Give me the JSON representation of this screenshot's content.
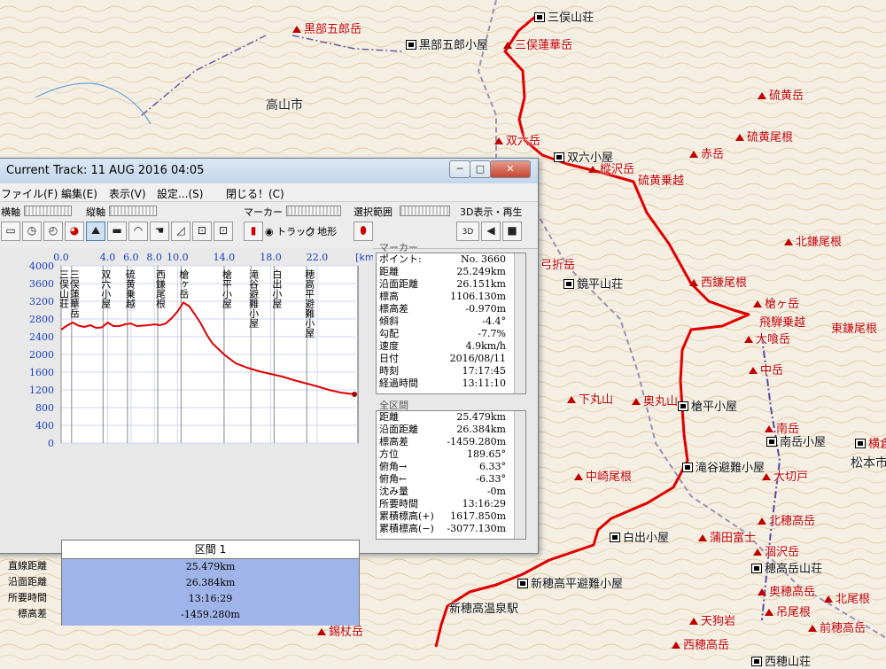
{
  "map": {
    "labels": [
      {
        "text": "黒部五郎岳",
        "cls": "maplabel",
        "x": 330,
        "y": 22,
        "icon": "mtn"
      },
      {
        "text": "黒部五郎小屋",
        "cls": "maplabel black",
        "x": 458,
        "y": 40,
        "icon": "hut"
      },
      {
        "text": "三俣山荘",
        "cls": "maplabel black",
        "x": 603,
        "y": 9,
        "icon": "hut"
      },
      {
        "text": "三俣蓮華岳",
        "cls": "maplabel",
        "x": 568,
        "y": 40,
        "icon": "mtn"
      },
      {
        "text": "高山市",
        "cls": "maplabel city",
        "x": 300,
        "y": 108,
        "icon": ""
      },
      {
        "text": "双六岳",
        "cls": "maplabel",
        "x": 558,
        "y": 148,
        "icon": "mtn"
      },
      {
        "text": "双六小屋",
        "cls": "maplabel black",
        "x": 625,
        "y": 167,
        "icon": "hut"
      },
      {
        "text": "樅沢岳",
        "cls": "maplabel",
        "x": 664,
        "y": 180,
        "icon": "mtn"
      },
      {
        "text": "硫黄乗越",
        "cls": "maplabel",
        "x": 720,
        "y": 193,
        "icon": ""
      },
      {
        "text": "硫黄岳",
        "cls": "maplabel",
        "x": 855,
        "y": 97,
        "icon": "mtn"
      },
      {
        "text": "硫黄尾根",
        "cls": "maplabel",
        "x": 830,
        "y": 144,
        "icon": "mtn"
      },
      {
        "text": "赤岳",
        "cls": "maplabel",
        "x": 778,
        "y": 163,
        "icon": "mtn"
      },
      {
        "text": "北鎌尾根",
        "cls": "maplabel",
        "x": 885,
        "y": 262,
        "icon": "mtn"
      },
      {
        "text": "弓折岳",
        "cls": "maplabel",
        "x": 610,
        "y": 288,
        "icon": ""
      },
      {
        "text": "鏡平山荘",
        "cls": "maplabel black",
        "x": 636,
        "y": 310,
        "icon": "hut"
      },
      {
        "text": "西鎌尾根",
        "cls": "maplabel",
        "x": 778,
        "y": 308,
        "icon": "mtn"
      },
      {
        "text": "槍ヶ岳",
        "cls": "maplabel",
        "x": 850,
        "y": 332,
        "icon": "mtn"
      },
      {
        "text": "飛騨乗越",
        "cls": "maplabel",
        "x": 857,
        "y": 353,
        "icon": ""
      },
      {
        "text": "東鎌尾根",
        "cls": "maplabel",
        "x": 938,
        "y": 360,
        "icon": ""
      },
      {
        "text": "大喰岳",
        "cls": "maplabel",
        "x": 840,
        "y": 372,
        "icon": "mtn"
      },
      {
        "text": "中岳",
        "cls": "maplabel",
        "x": 845,
        "y": 407,
        "icon": "mtn"
      },
      {
        "text": "下丸山",
        "cls": "maplabel",
        "x": 640,
        "y": 440,
        "icon": "mtn"
      },
      {
        "text": "奥丸山",
        "cls": "maplabel",
        "x": 713,
        "y": 442,
        "icon": "mtn"
      },
      {
        "text": "槍平小屋",
        "cls": "maplabel black",
        "x": 765,
        "y": 448,
        "icon": "hut"
      },
      {
        "text": "南岳",
        "cls": "maplabel",
        "x": 863,
        "y": 473,
        "icon": "mtn"
      },
      {
        "text": "南岳小屋",
        "cls": "maplabel black",
        "x": 865,
        "y": 488,
        "icon": "hut"
      },
      {
        "text": "中崎尾根",
        "cls": "maplabel",
        "x": 648,
        "y": 527,
        "icon": "mtn"
      },
      {
        "text": "滝谷避難小屋",
        "cls": "maplabel black",
        "x": 770,
        "y": 517,
        "icon": "hut"
      },
      {
        "text": "大切戸",
        "cls": "maplabel",
        "x": 860,
        "y": 527,
        "icon": "mtn"
      },
      {
        "text": "横倉",
        "cls": "maplabel",
        "x": 965,
        "y": 490,
        "icon": "hut"
      },
      {
        "text": "松本市",
        "cls": "maplabel city",
        "x": 960,
        "y": 512,
        "icon": ""
      },
      {
        "text": "北穂高岳",
        "cls": "maplabel",
        "x": 855,
        "y": 577,
        "icon": "mtn"
      },
      {
        "text": "白出小屋",
        "cls": "maplabel black",
        "x": 688,
        "y": 596,
        "icon": "hut"
      },
      {
        "text": "蒲田富士",
        "cls": "maplabel",
        "x": 788,
        "y": 596,
        "icon": "mtn"
      },
      {
        "text": "涸沢岳",
        "cls": "maplabel",
        "x": 850,
        "y": 612,
        "icon": "mtn"
      },
      {
        "text": "穂高岳山荘",
        "cls": "maplabel black",
        "x": 848,
        "y": 631,
        "icon": "hut"
      },
      {
        "text": "新穂高平避難小屋",
        "cls": "maplabel black",
        "x": 584,
        "y": 648,
        "icon": "hut"
      },
      {
        "text": "奥穂高岳",
        "cls": "maplabel",
        "x": 855,
        "y": 657,
        "icon": "mtn"
      },
      {
        "text": "北尾根",
        "cls": "maplabel",
        "x": 930,
        "y": 665,
        "icon": "mtn"
      },
      {
        "text": "新穂高温泉駅",
        "cls": "maplabel black",
        "x": 507,
        "y": 676,
        "icon": ""
      },
      {
        "text": "吊尾根",
        "cls": "maplabel",
        "x": 863,
        "y": 680,
        "icon": "mtn"
      },
      {
        "text": "天狗岩",
        "cls": "maplabel",
        "x": 778,
        "y": 690,
        "icon": "mtn"
      },
      {
        "text": "前穂高岳",
        "cls": "maplabel",
        "x": 912,
        "y": 698,
        "icon": "mtn"
      },
      {
        "text": "錫杖岳",
        "cls": "maplabel",
        "x": 358,
        "y": 702,
        "icon": "mtn"
      },
      {
        "text": "西穂高岳",
        "cls": "maplabel",
        "x": 758,
        "y": 717,
        "icon": "mtn"
      },
      {
        "text": "西穂山荘",
        "cls": "maplabel black",
        "x": 848,
        "y": 736,
        "icon": "hut"
      }
    ]
  },
  "window": {
    "title": "Current Track: 11 AUG 2016 04:05",
    "controls": {
      "min": "─",
      "max": "□",
      "close": "✕"
    },
    "menu": [
      "ファイル(F)",
      "編集(E)",
      "表示(V)",
      "設定...(S)",
      "閉じる！(C)"
    ],
    "toolbar": {
      "yoko_label": "横軸",
      "tate_label": "縦軸",
      "marker_label": "マーカー",
      "select_label": "選択範囲",
      "view3d_label": "3D表示・再生",
      "track_radio": "トラック",
      "terrain_radio": "地形",
      "btn_3d": "3D"
    }
  },
  "chart_data": {
    "type": "line",
    "x_unit": "[km]",
    "x_ticks": [
      "0.0",
      "4.0",
      "6.0",
      "8.0",
      "10.0",
      "14.0",
      "18.0",
      "22.0"
    ],
    "x_tick_vals": [
      0,
      4,
      6,
      8,
      10,
      14,
      18,
      22
    ],
    "xlim": [
      0,
      25.5
    ],
    "ylim": [
      0,
      4000
    ],
    "y_ticks": [
      "4000",
      "3600",
      "3200",
      "2800",
      "2400",
      "2000",
      "1600",
      "1200",
      "800",
      "400",
      "0"
    ],
    "x": [
      0,
      0.5,
      1,
      1.5,
      2,
      2.5,
      3,
      3.5,
      4,
      4.5,
      5,
      5.5,
      6,
      6.5,
      7,
      7.5,
      8,
      8.5,
      9,
      9.5,
      10,
      10.5,
      11,
      11.5,
      12,
      12.5,
      13,
      14,
      15,
      16,
      17,
      18,
      19,
      20,
      21,
      22,
      23,
      24,
      25.2
    ],
    "y": [
      2560,
      2650,
      2720,
      2650,
      2620,
      2660,
      2600,
      2610,
      2720,
      2640,
      2640,
      2680,
      2700,
      2640,
      2650,
      2660,
      2680,
      2660,
      2700,
      2820,
      2970,
      3170,
      3090,
      2900,
      2700,
      2450,
      2250,
      2000,
      1800,
      1700,
      1620,
      1560,
      1500,
      1420,
      1350,
      1280,
      1200,
      1140,
      1100
    ],
    "waypoints": [
      {
        "x": 0.0,
        "text": "三俣山荘"
      },
      {
        "x": 0.9,
        "text": "三俣蓮華岳"
      },
      {
        "x": 3.6,
        "text": "双六小屋"
      },
      {
        "x": 5.7,
        "text": "硫黄乗越"
      },
      {
        "x": 8.3,
        "text": "西鎌尾根"
      },
      {
        "x": 10.3,
        "text": "槍ヶ岳"
      },
      {
        "x": 14.0,
        "text": "槍平小屋"
      },
      {
        "x": 16.3,
        "text": "滝谷避難小屋"
      },
      {
        "x": 18.3,
        "text": "白出小屋"
      },
      {
        "x": 21.1,
        "text": "穂高平避難小屋"
      }
    ]
  },
  "section": {
    "title": "区間 1",
    "labels": [
      "直線距離",
      "沿面距離",
      "所要時間",
      "標高差"
    ],
    "values": [
      "25.479km",
      "26.384km",
      "13:16:29",
      "-1459.280m"
    ]
  },
  "marker_panel": {
    "title": "マーカー",
    "rows": [
      {
        "k": "ポイント:",
        "v": "No. 3660"
      },
      {
        "k": "距離",
        "v": "25.249km"
      },
      {
        "k": "沿面距離",
        "v": "26.151km"
      },
      {
        "k": "標高",
        "v": "1106.130m"
      },
      {
        "k": "標高差",
        "v": "-0.970m"
      },
      {
        "k": "傾斜",
        "v": "-4.4°"
      },
      {
        "k": "勾配",
        "v": "-7.7%"
      },
      {
        "k": "速度",
        "v": "4.9km/h"
      },
      {
        "k": "日付",
        "v": "2016/08/11"
      },
      {
        "k": "時刻",
        "v": "17:17:45"
      },
      {
        "k": "経過時間",
        "v": "13:11:10"
      }
    ]
  },
  "total_panel": {
    "title": "全区間",
    "rows": [
      {
        "k": "距離",
        "v": "25.479km"
      },
      {
        "k": "沿面距離",
        "v": "26.384km"
      },
      {
        "k": "標高差",
        "v": "-1459.280m"
      },
      {
        "k": "方位",
        "v": "189.65°"
      },
      {
        "k": "俯角→",
        "v": "6.33°"
      },
      {
        "k": "俯角←",
        "v": "-6.33°"
      },
      {
        "k": "沈み量",
        "v": "-0m"
      },
      {
        "k": "所要時間",
        "v": "13:16:29"
      },
      {
        "k": "累積標高(+)",
        "v": "1617.850m"
      },
      {
        "k": "累積標高(−)",
        "v": "-3077.130m"
      }
    ]
  },
  "colors": {
    "track": "#e00000",
    "chart_bg": "#ffffff",
    "section_bg": "#9fb4e8",
    "axis_text": "#1a3fbf"
  }
}
